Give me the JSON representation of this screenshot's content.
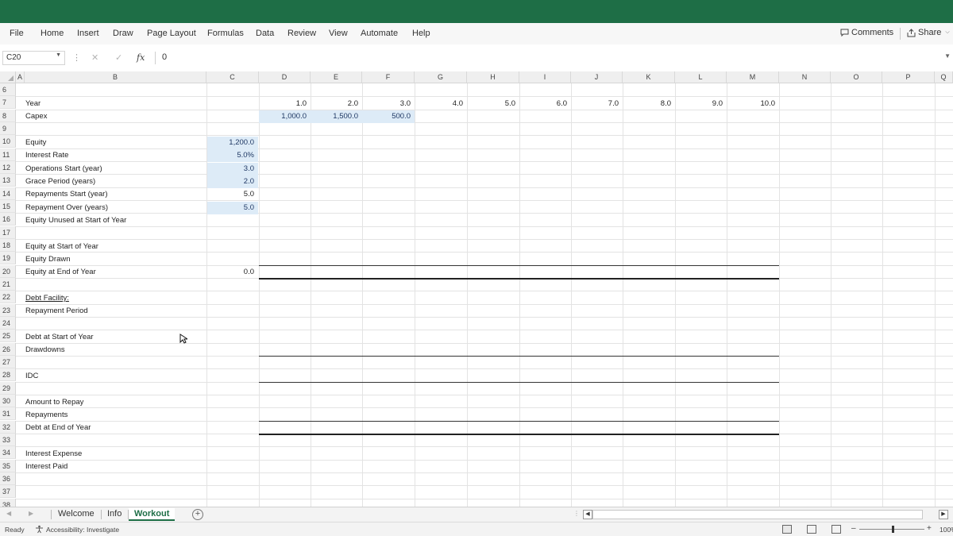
{
  "menu": {
    "items": [
      "File",
      "Home",
      "Insert",
      "Draw",
      "Page Layout",
      "Formulas",
      "Data",
      "Review",
      "View",
      "Automate",
      "Help"
    ],
    "comments_label": "Comments",
    "share_label": "Share"
  },
  "formula_bar": {
    "name_box": "C20",
    "fx_label": "fx",
    "value": "0"
  },
  "columns": [
    "A",
    "B",
    "C",
    "D",
    "E",
    "F",
    "G",
    "H",
    "I",
    "J",
    "K",
    "L",
    "M",
    "N",
    "O",
    "P",
    "Q"
  ],
  "rows": [
    "6",
    "7",
    "8",
    "9",
    "10",
    "11",
    "12",
    "13",
    "14",
    "15",
    "16",
    "17",
    "18",
    "19",
    "20",
    "21",
    "22",
    "23",
    "24",
    "25",
    "26",
    "27",
    "28",
    "29",
    "30",
    "31",
    "32",
    "33",
    "34",
    "35",
    "36",
    "37",
    "38"
  ],
  "labels": {
    "r7": "Year",
    "r8": "Capex",
    "r10": "Equity",
    "r11": "Interest Rate",
    "r12": "Operations Start (year)",
    "r13": "Grace Period (years)",
    "r14": "Repayments Start (year)",
    "r15": "Repayment Over (years)",
    "r16": "Equity Unused at Start of Year",
    "r18": "Equity at Start of Year",
    "r19": "Equity Drawn",
    "r20": "Equity at End of Year",
    "r22": "Debt Facility:",
    "r23": "Repayment Period",
    "r25": "Debt at Start of Year",
    "r26": "Drawdowns",
    "r28": "IDC",
    "r30": "Amount to Repay",
    "r31": "Repayments",
    "r32": "Debt at End of Year",
    "r34": "Interest Expense",
    "r35": "Interest Paid"
  },
  "inputs": {
    "equity": "1,200.0",
    "interest_rate": "5.0%",
    "operations_start": "3.0",
    "grace_period": "2.0",
    "repayments_start": "5.0",
    "repayment_over": "5.0",
    "equity_end_c": "0.0"
  },
  "years": [
    "1.0",
    "2.0",
    "3.0",
    "4.0",
    "5.0",
    "6.0",
    "7.0",
    "8.0",
    "9.0",
    "10.0"
  ],
  "capex": [
    "1,000.0",
    "1,500.0",
    "500.0"
  ],
  "sheets": {
    "tabs": [
      "Welcome",
      "Info",
      "Workout"
    ],
    "active": "Workout",
    "add_label": "+"
  },
  "status": {
    "ready": "Ready",
    "accessibility": "Accessibility: Investigate",
    "zoom": "100%"
  },
  "colors": {
    "brand": "#1e6e46",
    "input_fill": "#ddebf7"
  }
}
